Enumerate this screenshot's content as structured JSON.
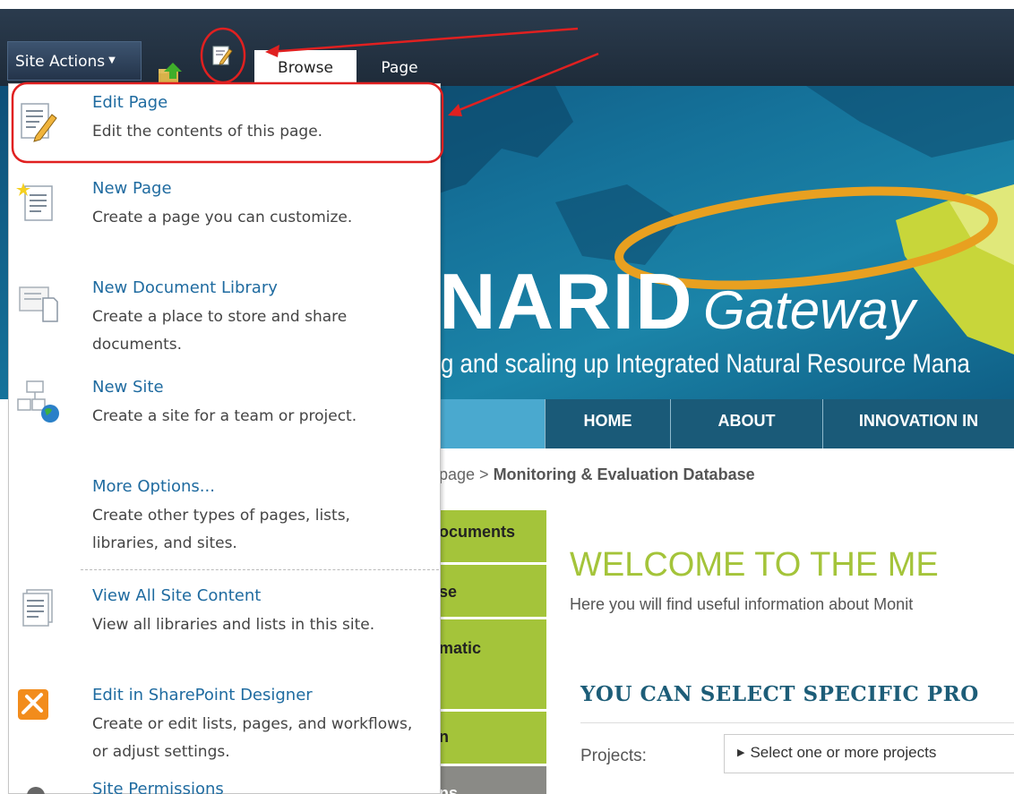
{
  "ribbon": {
    "site_actions_label": "Site Actions",
    "tabs": [
      {
        "label": "Browse"
      },
      {
        "label": "Page"
      }
    ]
  },
  "menu": {
    "items": [
      {
        "title": "Edit Page",
        "desc": "Edit the contents of this page.",
        "icon": "edit-page-icon"
      },
      {
        "title": "New Page",
        "desc": "Create a page you can customize.",
        "icon": "new-page-icon"
      },
      {
        "title": "New Document Library",
        "desc": "Create a place to store and share documents.",
        "icon": "document-library-icon"
      },
      {
        "title": "New Site",
        "desc": "Create a site for a team or project.",
        "icon": "new-site-icon"
      },
      {
        "title": "More Options...",
        "desc": "Create other types of pages, lists, libraries, and sites.",
        "icon": ""
      },
      {
        "title": "View All Site Content",
        "desc": "View all libraries and lists in this site.",
        "icon": "site-content-icon"
      },
      {
        "title": "Edit in SharePoint Designer",
        "desc": "Create or edit lists, pages, and workflows, or adjust settings.",
        "icon": "sharepoint-designer-icon"
      },
      {
        "title": "Site Permissions",
        "desc": "",
        "icon": "permissions-icon"
      }
    ]
  },
  "banner": {
    "title": "NARID",
    "title_suffix": "Gateway",
    "subtitle": "g and scaling up Integrated Natural Resource Mana"
  },
  "nav": {
    "items": [
      "HOME",
      "ABOUT",
      "INNOVATION IN"
    ]
  },
  "breadcrumb": {
    "prefix": "page > ",
    "current": "Monitoring & Evaluation Database"
  },
  "left_nav": {
    "items": [
      "ocuments",
      "se",
      "matic",
      "n",
      "ns"
    ]
  },
  "content": {
    "welcome": "WELCOME TO THE ME",
    "welcome_sub": "Here you will find useful information about Monit",
    "select_title": "YOU CAN SELECT SPECIFIC PRO",
    "projects_label": "Projects:",
    "projects_placeholder": "Select one or more projects"
  },
  "colors": {
    "ribbon": "#24344a",
    "link": "#1f6ba0",
    "annotation": "#e02020",
    "left_nav_green": "#a4c43a",
    "nav_blue": "#1a5a78"
  }
}
